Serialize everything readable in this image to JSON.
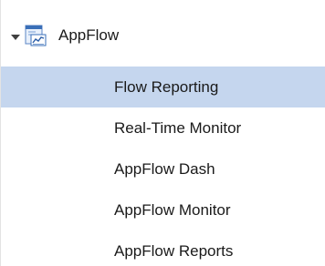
{
  "tree": {
    "root": {
      "label": "AppFlow",
      "icon": "report-chart-icon",
      "expanded": true
    },
    "children": [
      {
        "label": "Flow Reporting",
        "selected": true
      },
      {
        "label": "Real-Time Monitor",
        "selected": false
      },
      {
        "label": "AppFlow Dash",
        "selected": false
      },
      {
        "label": "AppFlow Monitor",
        "selected": false
      },
      {
        "label": "AppFlow Reports",
        "selected": false
      }
    ]
  },
  "colors": {
    "selection": "#c5d6ee",
    "text": "#1a1a1a",
    "icon_blue": "#3a6fb8"
  }
}
